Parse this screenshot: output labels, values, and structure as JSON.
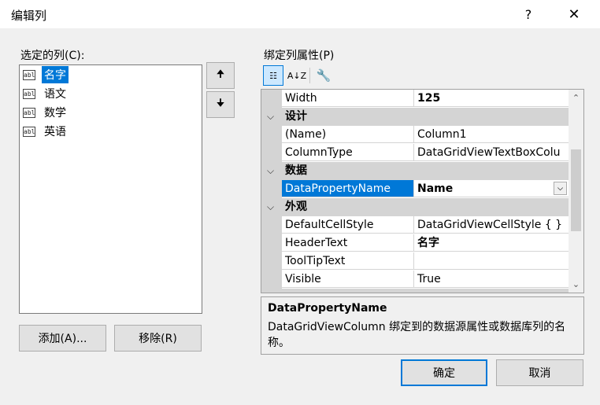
{
  "dialog": {
    "title": "编辑列",
    "help": "?",
    "close": "✕"
  },
  "left": {
    "label": "选定的列(C):",
    "items": [
      {
        "icon": "abl",
        "label": "名字",
        "selected": true
      },
      {
        "icon": "abl",
        "label": "语文",
        "selected": false
      },
      {
        "icon": "abl",
        "label": "数学",
        "selected": false
      },
      {
        "icon": "abl",
        "label": "英语",
        "selected": false
      }
    ],
    "move_up": "🠉",
    "move_down": "🠋",
    "add_button": "添加(A)...",
    "remove_button": "移除(R)"
  },
  "right": {
    "label": "绑定列属性(P)",
    "toolbar": {
      "categorized": "☷",
      "alphabetical": "A↓Z",
      "wrench": "🔧"
    },
    "properties": [
      {
        "type": "prop",
        "name": "Width",
        "value": "125",
        "bold": true
      },
      {
        "type": "cat",
        "name": "设计",
        "chevron": "⌵"
      },
      {
        "type": "prop",
        "name": "(Name)",
        "value": "Column1"
      },
      {
        "type": "prop",
        "name": "ColumnType",
        "value": "DataGridViewTextBoxColu"
      },
      {
        "type": "cat",
        "name": "数据",
        "chevron": "⌵"
      },
      {
        "type": "prop",
        "name": "DataPropertyName",
        "value": "Name",
        "bold": true,
        "selected": true,
        "dropdown": "⌵"
      },
      {
        "type": "cat",
        "name": "外观",
        "chevron": "⌵"
      },
      {
        "type": "prop",
        "name": "DefaultCellStyle",
        "value": "DataGridViewCellStyle { }"
      },
      {
        "type": "prop",
        "name": "HeaderText",
        "value": "名字",
        "bold": true
      },
      {
        "type": "prop",
        "name": "ToolTipText",
        "value": ""
      },
      {
        "type": "prop",
        "name": "Visible",
        "value": "True"
      }
    ],
    "scroll": {
      "up": "⌃",
      "down": "⌄"
    },
    "description": {
      "title": "DataPropertyName",
      "text": "DataGridViewColumn 绑定到的数据源属性或数据库列的名称。"
    }
  },
  "footer": {
    "ok": "确定",
    "cancel": "取消"
  }
}
